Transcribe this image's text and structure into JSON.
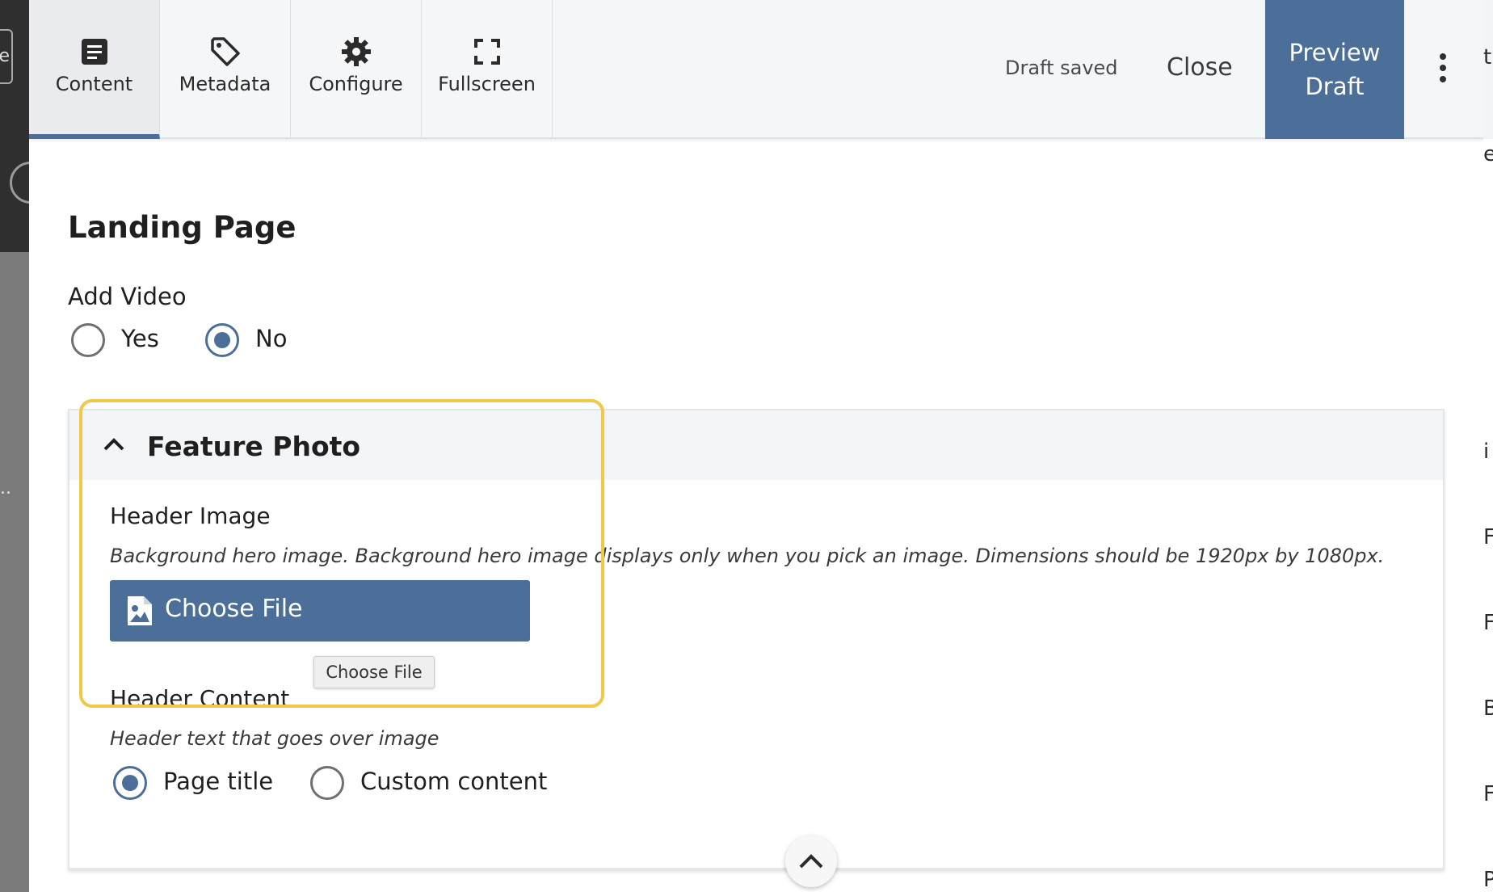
{
  "toolbar": {
    "tabs": [
      {
        "label": "Content",
        "icon": "content-icon",
        "active": true
      },
      {
        "label": "Metadata",
        "icon": "tag-icon",
        "active": false
      },
      {
        "label": "Configure",
        "icon": "gear-icon",
        "active": false
      },
      {
        "label": "Fullscreen",
        "icon": "fullscreen-icon",
        "active": false
      }
    ],
    "status": "Draft saved",
    "close_label": "Close",
    "preview_label_line1": "Preview",
    "preview_label_line2": "Draft"
  },
  "page": {
    "title": "Landing Page",
    "add_video": {
      "label": "Add Video",
      "options": [
        "Yes",
        "No"
      ],
      "selected": "No"
    }
  },
  "feature_photo": {
    "title": "Feature Photo",
    "expanded": true,
    "header_image": {
      "label": "Header Image",
      "help": "Background hero image. Background hero image displays only when you pick an image. Dimensions should be 1920px by 1080px.",
      "button_label": "Choose File",
      "tooltip": "Choose File"
    },
    "header_content": {
      "label": "Header Content",
      "help": "Header text that goes over image",
      "options": [
        "Page title",
        "Custom content"
      ],
      "selected": "Page title"
    }
  },
  "colors": {
    "accent": "#4b6f99",
    "highlight": "#f1c84a",
    "toolbar_bg": "#f5f6f8"
  }
}
